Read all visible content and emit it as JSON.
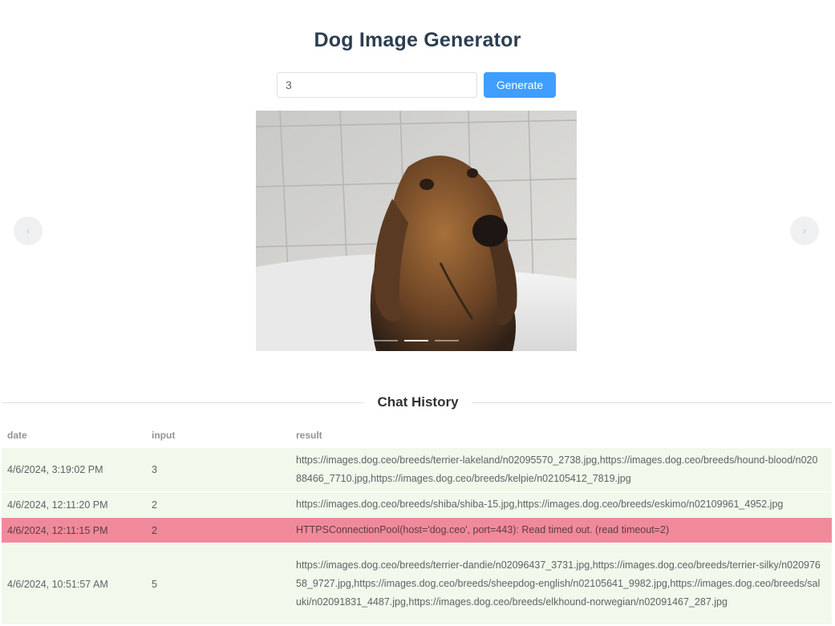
{
  "app": {
    "title": "Dog Image Generator"
  },
  "generator": {
    "input_value": "3",
    "button_label": "Generate"
  },
  "carousel": {
    "prev_icon": "chevron-left-icon",
    "next_icon": "chevron-right-icon",
    "prev_glyph": "‹",
    "next_glyph": "›",
    "active_index": 1,
    "count": 3
  },
  "history": {
    "heading": "Chat History",
    "columns": {
      "date": "date",
      "input": "input",
      "result": "result"
    },
    "rows": [
      {
        "date": "4/6/2024, 3:19:02 PM",
        "input": "3",
        "result": "https://images.dog.ceo/breeds/terrier-lakeland/n02095570_2738.jpg,https://images.dog.ceo/breeds/hound-blood/n02088466_7710.jpg,https://images.dog.ceo/breeds/kelpie/n02105412_7819.jpg",
        "status": "success"
      },
      {
        "date": "4/6/2024, 12:11:20 PM",
        "input": "2",
        "result": "https://images.dog.ceo/breeds/shiba/shiba-15.jpg,https://images.dog.ceo/breeds/eskimo/n02109961_4952.jpg",
        "status": "success"
      },
      {
        "date": "4/6/2024, 12:11:15 PM",
        "input": "2",
        "result": "HTTPSConnectionPool(host='dog.ceo', port=443): Read timed out. (read timeout=2)",
        "status": "error"
      },
      {
        "date": "4/6/2024, 10:51:57 AM",
        "input": "5",
        "result": "https://images.dog.ceo/breeds/terrier-dandie/n02096437_3731.jpg,https://images.dog.ceo/breeds/terrier-silky/n02097658_9727.jpg,https://images.dog.ceo/breeds/sheepdog-english/n02105641_9982.jpg,https://images.dog.ceo/breeds/saluki/n02091831_4487.jpg,https://images.dog.ceo/breeds/elkhound-norwegian/n02091467_287.jpg",
        "status": "success"
      }
    ]
  },
  "colors": {
    "accent": "#409eff",
    "success_row": "#f0f9eb",
    "error_row": "#f08a9b",
    "title": "#2c3e50"
  }
}
